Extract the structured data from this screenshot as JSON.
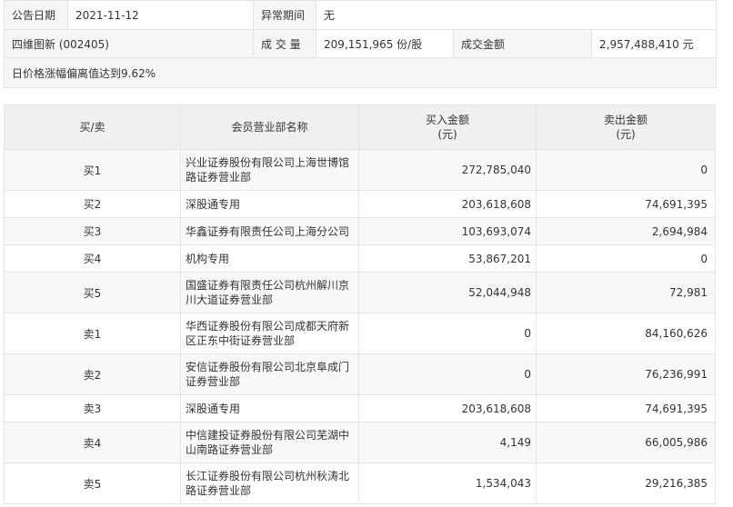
{
  "summary": {
    "date_label": "公告日期",
    "date_value": "2021-11-12",
    "period_label": "异常期间",
    "period_value": "无",
    "stock": "四维图新 (002405)",
    "volume_label": "成 交 量",
    "volume_value": "209,151,965 份/股",
    "amount_label": "成交金额",
    "amount_value": "2,957,488,410 元",
    "note": "日价格涨幅偏离值达到9.62%"
  },
  "table": {
    "headers": {
      "side": "买/卖",
      "broker": "会员营业部名称",
      "buy_line1": "买入金额",
      "buy_line2": "(元)",
      "sell_line1": "卖出金额",
      "sell_line2": "(元)"
    },
    "rows": [
      {
        "side": "买1",
        "broker": "兴业证券股份有限公司上海世博馆路证券营业部",
        "buy": "272,785,040",
        "sell": "0"
      },
      {
        "side": "买2",
        "broker": "深股通专用",
        "buy": "203,618,608",
        "sell": "74,691,395"
      },
      {
        "side": "买3",
        "broker": "华鑫证券有限责任公司上海分公司",
        "buy": "103,693,074",
        "sell": "2,694,984"
      },
      {
        "side": "买4",
        "broker": "机构专用",
        "buy": "53,867,201",
        "sell": "0"
      },
      {
        "side": "买5",
        "broker": "国盛证券有限责任公司杭州解川京川大道证券营业部",
        "buy": "52,044,948",
        "sell": "72,981"
      },
      {
        "side": "卖1",
        "broker": "华西证券股份有限公司成都天府新区正东中街证券营业部",
        "buy": "0",
        "sell": "84,160,626"
      },
      {
        "side": "卖2",
        "broker": "安信证券股份有限公司北京阜成门证券营业部",
        "buy": "0",
        "sell": "76,236,991"
      },
      {
        "side": "卖3",
        "broker": "深股通专用",
        "buy": "203,618,608",
        "sell": "74,691,395"
      },
      {
        "side": "卖4",
        "broker": "中信建投证券股份有限公司芜湖中山南路证券营业部",
        "buy": "4,149",
        "sell": "66,005,986"
      },
      {
        "side": "卖5",
        "broker": "长江证券股份有限公司杭州秋涛北路证券营业部",
        "buy": "1,534,043",
        "sell": "29,216,385"
      }
    ]
  }
}
